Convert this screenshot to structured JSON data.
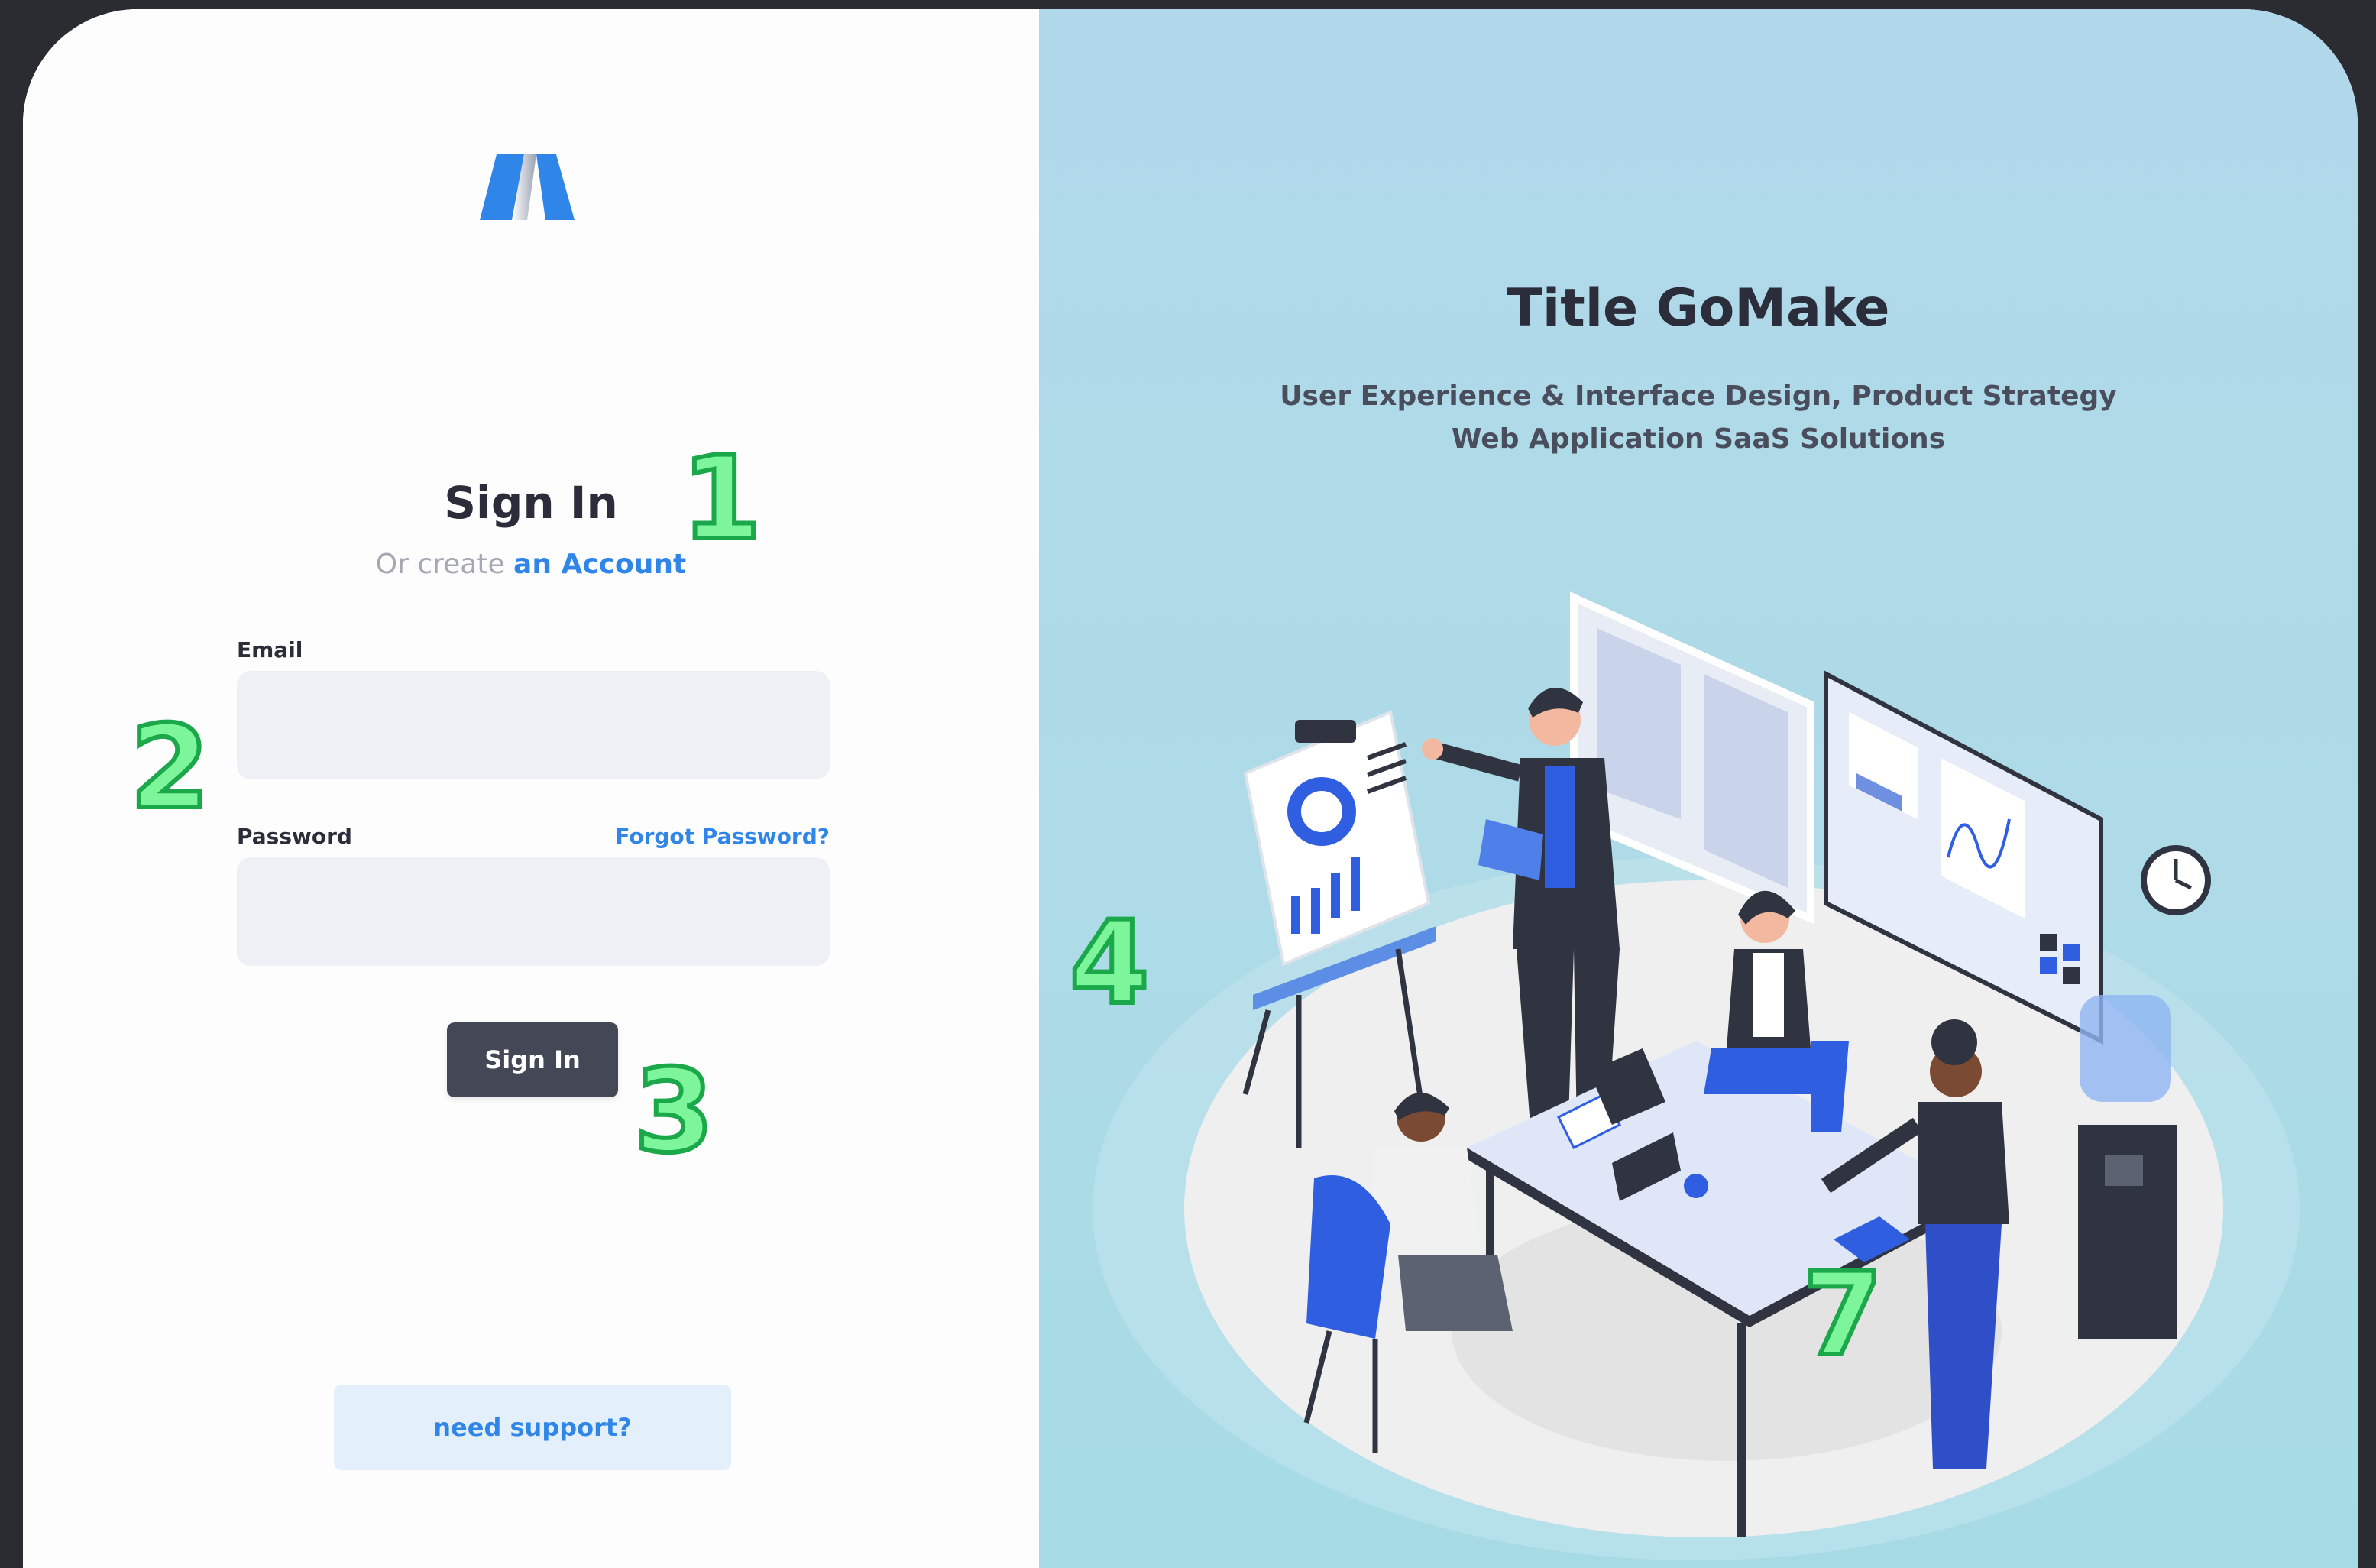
{
  "login": {
    "title": "Sign In",
    "create_prefix": "Or create ",
    "create_link": "an Account",
    "email_label": "Email",
    "email_value": "",
    "password_label": "Password",
    "password_value": "",
    "forgot_link": "Forgot Password?",
    "submit_label": "Sign In",
    "support_label": "need support?"
  },
  "hero": {
    "title": "Title GoMake",
    "subtitle_line1": "User Experience & Interface Design, Product Strategy",
    "subtitle_line2": "Web Application SaaS Solutions"
  },
  "markers": [
    "1",
    "2",
    "3",
    "4",
    "7"
  ],
  "colors": {
    "accent": "#2f86e8",
    "button": "#434756",
    "input_bg": "#edf0f4",
    "hero_bg": "#b0d8ea",
    "marker_fill": "#7df59a"
  }
}
